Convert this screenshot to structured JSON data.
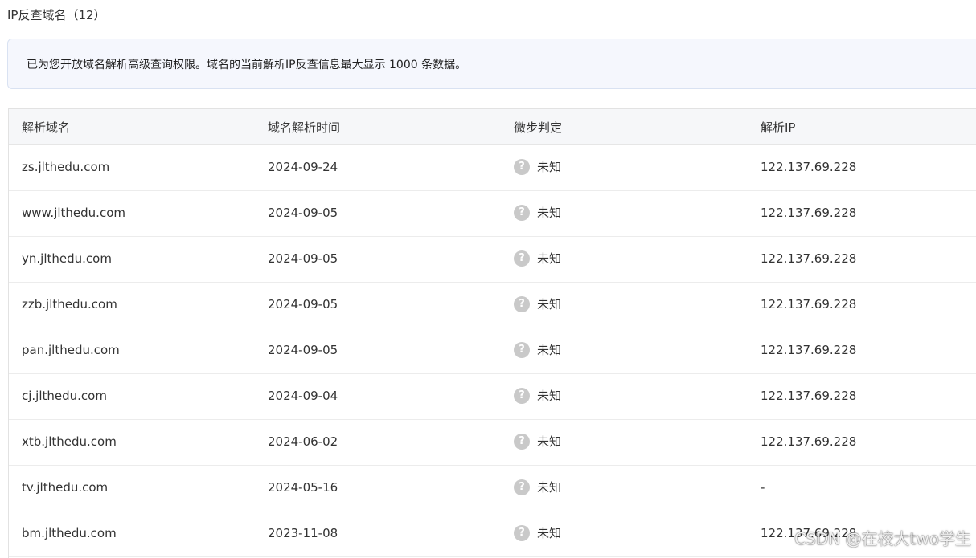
{
  "section": {
    "title": "IP反查域名（12）"
  },
  "notice": {
    "text": "已为您开放域名解析高级查询权限。域名的当前解析IP反查信息最大显示 1000 条数据。"
  },
  "table": {
    "headers": [
      "解析域名",
      "域名解析时间",
      "微步判定",
      "解析IP"
    ],
    "rows": [
      {
        "domain": "zs.jlthedu.com",
        "time": "2024-09-24",
        "verdict": "未知",
        "ip": "122.137.69.228"
      },
      {
        "domain": "www.jlthedu.com",
        "time": "2024-09-05",
        "verdict": "未知",
        "ip": "122.137.69.228"
      },
      {
        "domain": "yn.jlthedu.com",
        "time": "2024-09-05",
        "verdict": "未知",
        "ip": "122.137.69.228"
      },
      {
        "domain": "zzb.jlthedu.com",
        "time": "2024-09-05",
        "verdict": "未知",
        "ip": "122.137.69.228"
      },
      {
        "domain": "pan.jlthedu.com",
        "time": "2024-09-05",
        "verdict": "未知",
        "ip": "122.137.69.228"
      },
      {
        "domain": "cj.jlthedu.com",
        "time": "2024-09-04",
        "verdict": "未知",
        "ip": "122.137.69.228"
      },
      {
        "domain": "xtb.jlthedu.com",
        "time": "2024-06-02",
        "verdict": "未知",
        "ip": "122.137.69.228"
      },
      {
        "domain": "tv.jlthedu.com",
        "time": "2024-05-16",
        "verdict": "未知",
        "ip": "-"
      },
      {
        "domain": "bm.jlthedu.com",
        "time": "2023-11-08",
        "verdict": "未知",
        "ip": "122.137.69.228"
      }
    ]
  },
  "icons": {
    "verdict_icon": "question-mark-circle-icon",
    "verdict_glyph": "?"
  },
  "colors": {
    "notice_bg": "#f5f7fd",
    "header_bg": "#f6f7f9",
    "verdict_icon": "#c9c9c9"
  },
  "watermark": "CSDN @在校大two学生"
}
